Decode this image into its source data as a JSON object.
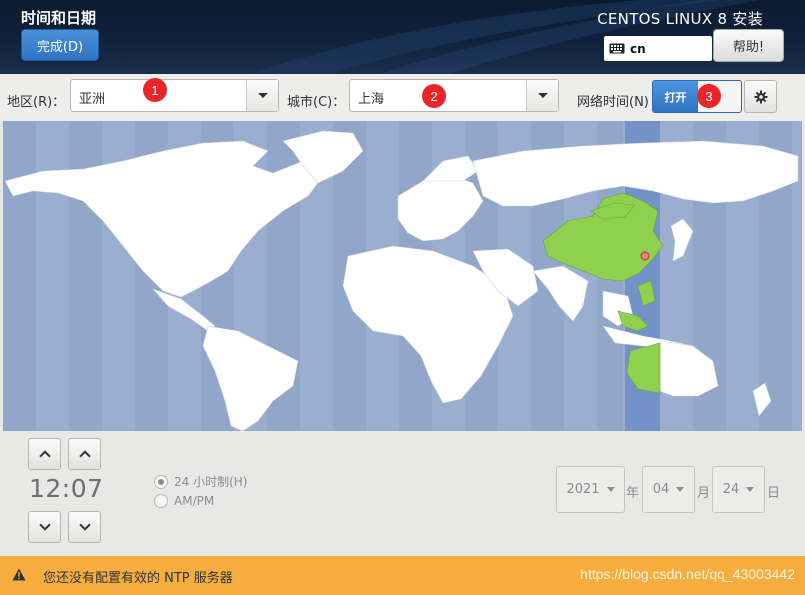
{
  "header": {
    "page_title": "时间和日期",
    "done_label": "完成(D)",
    "product_title": "CENTOS LINUX 8 安装",
    "keyboard_layout": "cn",
    "help_label": "帮助!"
  },
  "toolbar": {
    "region_label": "地区(R)：",
    "region_value": "亚洲",
    "city_label": "城市(C)：",
    "city_value": "上海",
    "network_time_label": "网络时间(N)",
    "network_time_toggle": "打开",
    "annotations": [
      "1",
      "2",
      "3"
    ]
  },
  "time": {
    "display": "12:07",
    "format_24h_label": "24 小时制(H)",
    "format_ampm_label": "AM/PM",
    "selected_format": "24h"
  },
  "date": {
    "year": "2021",
    "year_unit": "年",
    "month": "04",
    "month_unit": "月",
    "day": "24",
    "day_unit": "日"
  },
  "warning": {
    "message": "您还没有配置有效的 NTP 服务器",
    "watermark": "https://blog.csdn.net/qq_43003442"
  },
  "colors": {
    "accent_blue": "#2f74c3",
    "ocean": "#9aaecf",
    "timezone_highlight": "#7292c8",
    "land": "#ffffff",
    "selected_land": "#8fd14f",
    "warning_bar": "#f5ae3d",
    "badge_red": "#e8262a"
  }
}
